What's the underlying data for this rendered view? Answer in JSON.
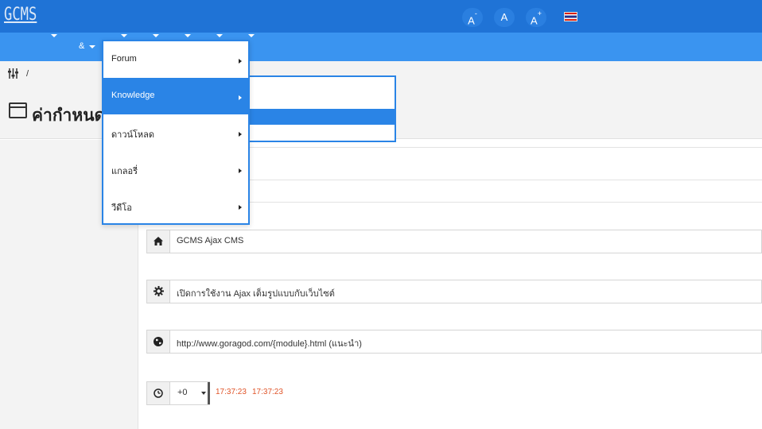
{
  "header": {
    "logo": "GCMS",
    "font_buttons": [
      {
        "label": "A",
        "sup": "-"
      },
      {
        "label": "A",
        "sup": ""
      },
      {
        "label": "A",
        "sup": "+"
      }
    ],
    "language_flag": "thai-flag-icon"
  },
  "nav": {
    "amp_label": "&"
  },
  "breadcrumb": {
    "icon": "settings-sliders-icon",
    "separator": "/"
  },
  "page": {
    "title": "ค่ากำหนด"
  },
  "menu": {
    "items": [
      {
        "label": "Forum"
      },
      {
        "label": "Knowledge"
      },
      {
        "label": "ดาวน์โหลด"
      },
      {
        "label": "แกลอรี่"
      },
      {
        "label": "วีดีโอ"
      }
    ],
    "active_index": 1
  },
  "form": {
    "site_title": "GCMS Ajax CMS",
    "ajax_mode": "เปิดการใช้งาน Ajax เต็มรูปแบบกับเว็บไซต์",
    "url_format": "http://www.goragod.com/{module}.html (แนะนำ)",
    "timezone_value": "+0",
    "server_time": "17:37:23",
    "local_time": "17:37:23"
  },
  "colors": {
    "topbar": "#1f73d6",
    "navbar": "#3a94f0",
    "accent": "#2a84e6",
    "time": "#e0552a"
  }
}
